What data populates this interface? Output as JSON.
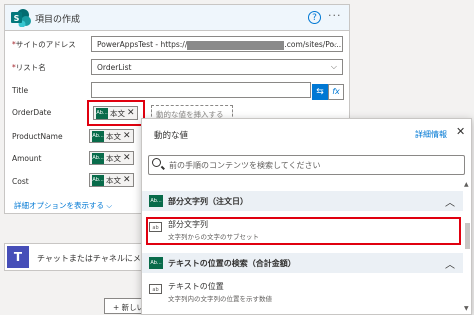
{
  "card": {
    "title": "項目の作成",
    "help_glyph": "?",
    "more_glyph": "···",
    "fields": {
      "site": {
        "label": "サイトのアドレス",
        "value_prefix": "PowerAppsTest - https://",
        "value_suffix": ".com/sites/Po..."
      },
      "list": {
        "label": "リスト名",
        "value": "OrderList"
      },
      "title": {
        "label": "Title"
      },
      "orderdate": {
        "label": "OrderDate",
        "token": "本文",
        "placeholder": "動的な値を挿入する"
      },
      "productname": {
        "label": "ProductName",
        "token": "本文"
      },
      "amount": {
        "label": "Amount",
        "token": "本文"
      },
      "cost": {
        "label": "Cost",
        "token": "本文"
      }
    },
    "advanced_link": "詳細オプションを表示する",
    "fx_label": "fx"
  },
  "chat": {
    "title": "チャットまたはチャネルにメッ"
  },
  "new_step": "+ 新しいス",
  "popup": {
    "title": "動的な値",
    "detail_link": "詳細情報",
    "search_placeholder": "前の手順のコンテンツを検索してください",
    "sections": [
      {
        "title": "部分文字列（注文日）",
        "item": {
          "title": "部分文字列",
          "desc": "文字列からの文字のサブセット"
        }
      },
      {
        "title": "テキストの位置の検索（合計金額）",
        "item": {
          "title": "テキストの位置",
          "desc": "文字列内の文字列の位置を示す数値"
        }
      }
    ]
  },
  "icons": {
    "sharepoint": "sharepoint-icon",
    "teams": "teams-icon",
    "token": "Ab..."
  },
  "colors": {
    "accent": "#0078d4",
    "highlight": "#e0000f",
    "token_green": "#086b4a"
  }
}
